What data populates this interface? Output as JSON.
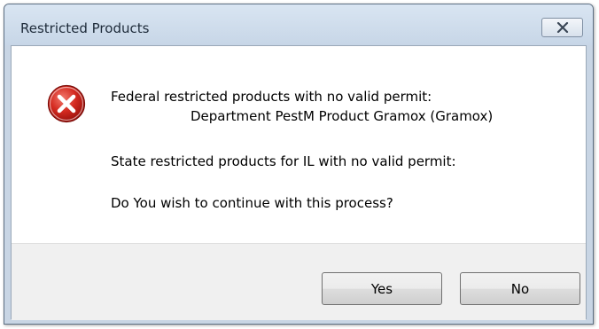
{
  "dialog": {
    "title": "Restricted Products",
    "close_icon": "close-x-icon",
    "icon": "error-icon",
    "messages": {
      "federal_heading": "Federal restricted products with no valid permit:",
      "federal_item": "Department PestM  Product Gramox (Gramox)",
      "state_heading": "State restricted products for IL with no valid permit:",
      "question": "Do You wish to continue with this process?"
    },
    "buttons": {
      "yes": "Yes",
      "no": "No"
    }
  },
  "colors": {
    "titlebar": "#c7d6e7",
    "error_red": "#c3201b",
    "footer": "#f0f0f0"
  }
}
